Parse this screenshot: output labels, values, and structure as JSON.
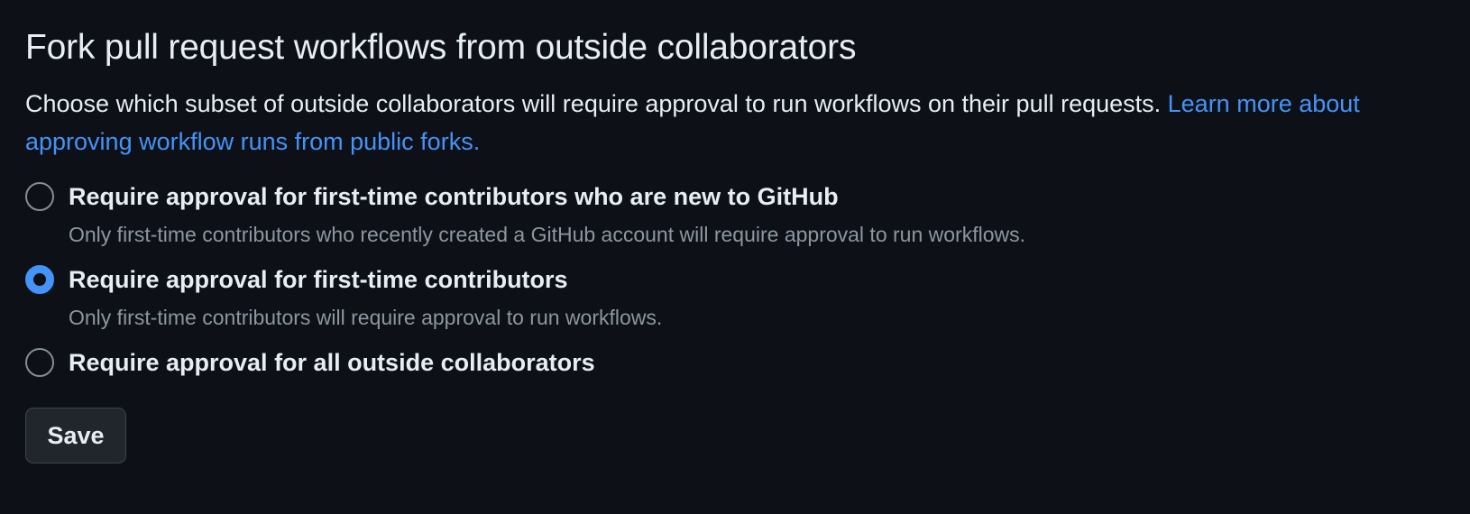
{
  "section": {
    "title": "Fork pull request workflows from outside collaborators",
    "description": "Choose which subset of outside collaborators will require approval to run workflows on their pull requests. ",
    "learn_more_link": "Learn more about approving workflow runs from public forks."
  },
  "options": [
    {
      "label": "Require approval for first-time contributors who are new to GitHub",
      "hint": "Only first-time contributors who recently created a GitHub account will require approval to run workflows.",
      "selected": false
    },
    {
      "label": "Require approval for first-time contributors",
      "hint": "Only first-time contributors will require approval to run workflows.",
      "selected": true
    },
    {
      "label": "Require approval for all outside collaborators",
      "hint": "",
      "selected": false
    }
  ],
  "actions": {
    "save_label": "Save"
  },
  "colors": {
    "background": "#0d1117",
    "text": "#e6edf3",
    "muted_text": "#8d96a0",
    "link": "#4493f8",
    "radio_selected": "#4493f8",
    "button_bg": "#21262d"
  }
}
